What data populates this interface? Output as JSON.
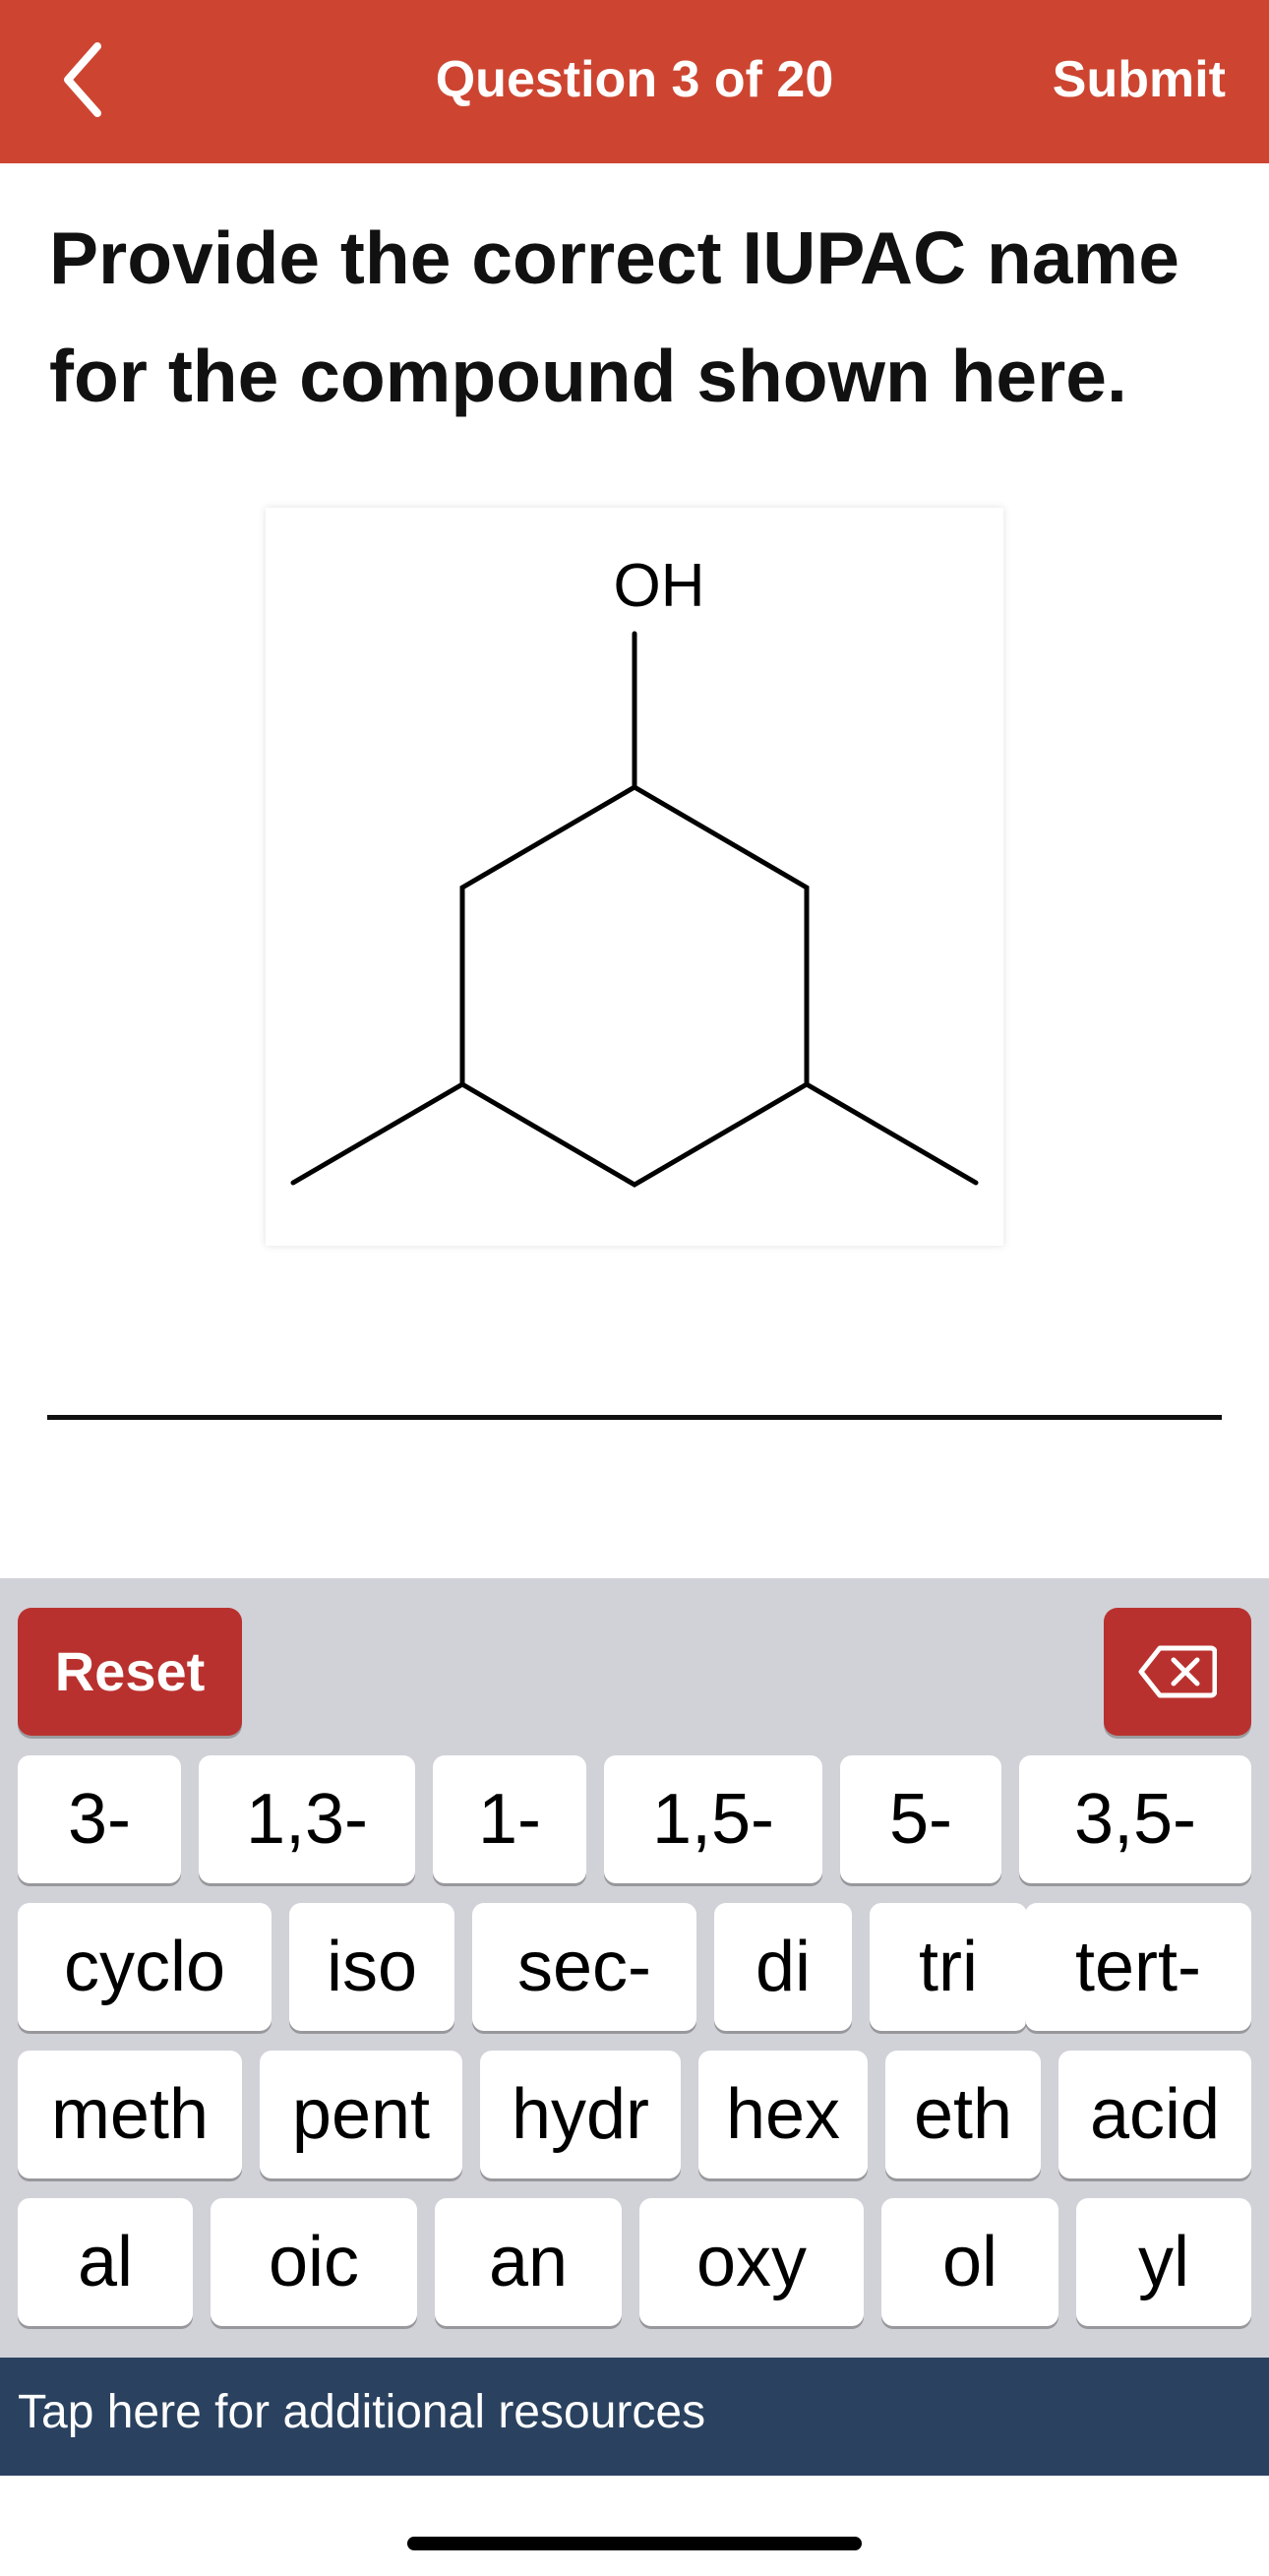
{
  "header": {
    "back_icon": "chevron-left-icon",
    "question_count": "Question 3 of 20",
    "submit_label": "Submit",
    "bar_color": "#cd4531"
  },
  "question": {
    "prompt": "Provide the correct IUPAC name for the compound shown here.",
    "structure_label": "OH"
  },
  "answer": {
    "value": ""
  },
  "keyboard": {
    "reset_label": "Reset",
    "backspace_icon": "backspace-icon",
    "rows": [
      [
        "3-",
        "1,3-",
        "1-",
        "1,5-",
        "5-",
        "3,5-"
      ],
      [
        "cyclo",
        "iso",
        "sec-",
        "di",
        "tri",
        "tert-"
      ],
      [
        "meth",
        "pent",
        "hydr",
        "hex",
        "eth",
        "acid"
      ],
      [
        "al",
        "oic",
        "an",
        "oxy",
        "ol",
        "yl"
      ]
    ],
    "action_color": "#b9312e"
  },
  "footer": {
    "resources_label": "Tap here for additional resources",
    "bar_color": "#2a4260"
  }
}
